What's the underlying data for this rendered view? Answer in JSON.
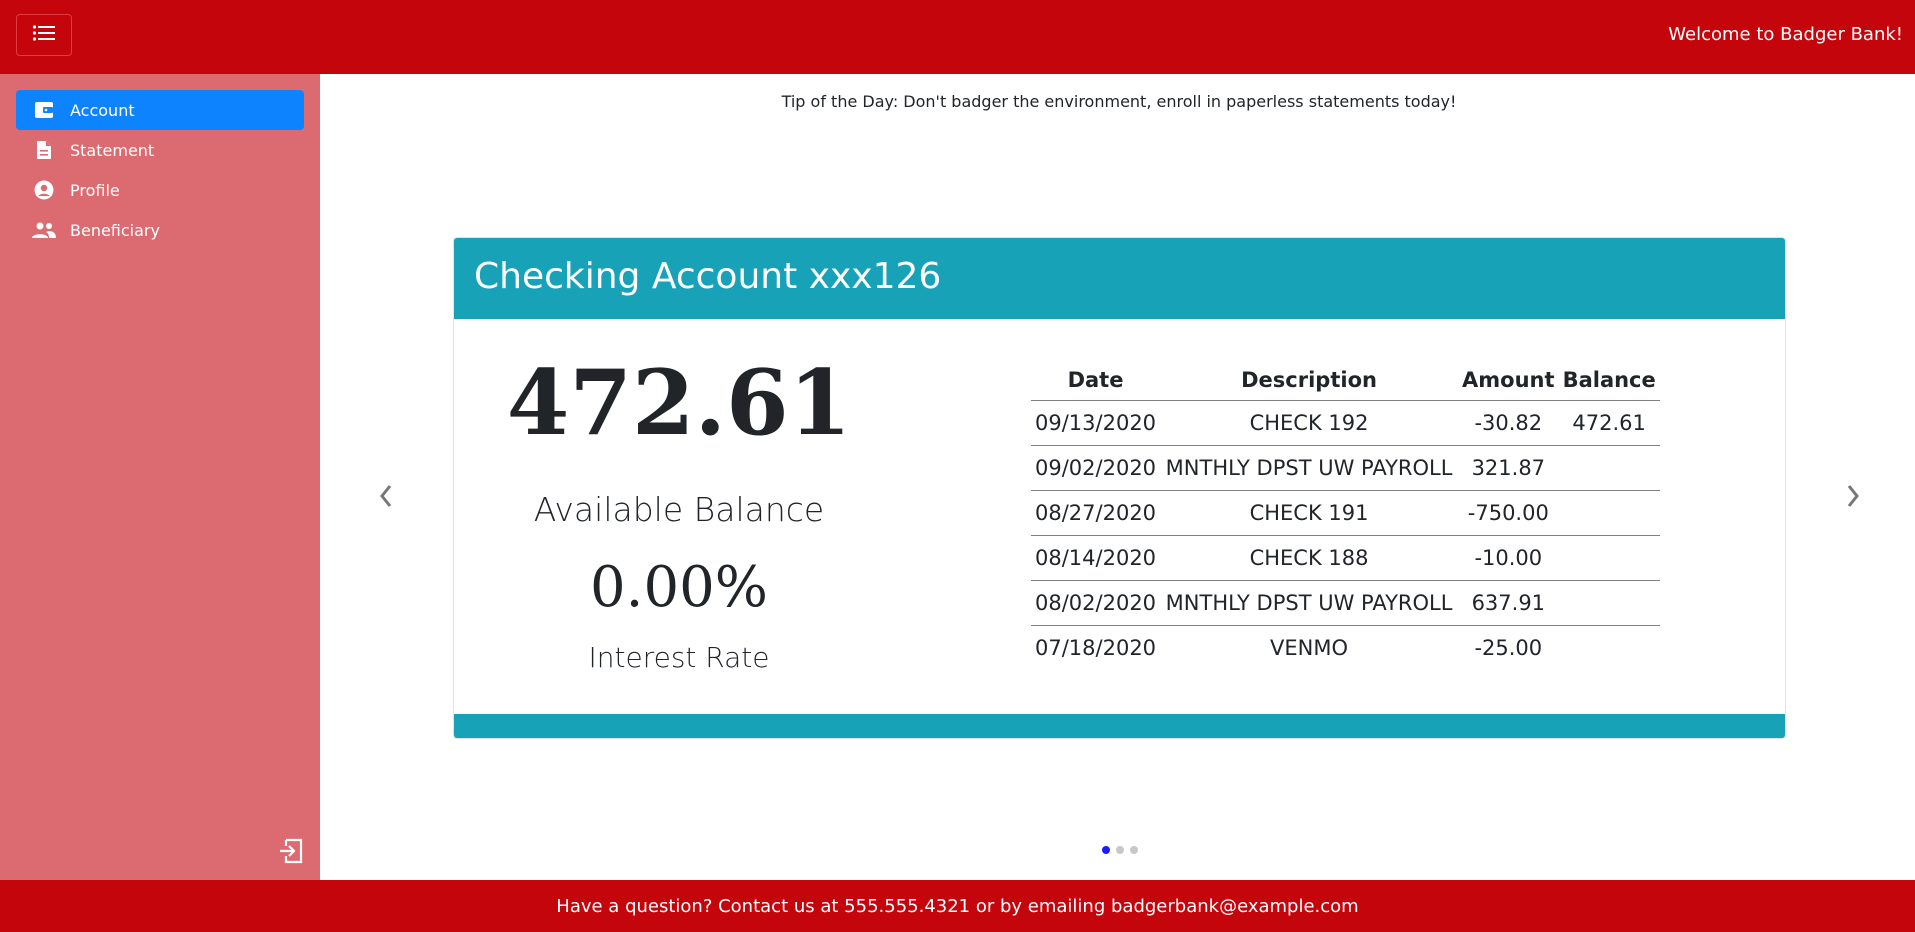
{
  "header": {
    "welcome": "Welcome to Badger Bank!",
    "menu_icon": "list-icon",
    "brand_color": "#c5050c"
  },
  "sidebar": {
    "items": [
      {
        "label": "Account",
        "icon": "wallet-icon",
        "active": true
      },
      {
        "label": "Statement",
        "icon": "document-icon",
        "active": false
      },
      {
        "label": "Profile",
        "icon": "user-circle-icon",
        "active": false
      },
      {
        "label": "Beneficiary",
        "icon": "people-icon",
        "active": false
      }
    ],
    "logout_icon": "logout-icon"
  },
  "main": {
    "tip": "Tip of the Day: Don't badger the environment, enroll in paperless statements today!",
    "account": {
      "title": "Checking Account xxx126",
      "balance": "472.61",
      "balance_label": "Available Balance",
      "rate": "0.00%",
      "rate_label": "Interest Rate",
      "columns": [
        "Date",
        "Description",
        "Amount",
        "Balance"
      ],
      "rows": [
        [
          "09/13/2020",
          "CHECK 192",
          "-30.82",
          "472.61"
        ],
        [
          "09/02/2020",
          "MNTHLY DPST UW PAYROLL",
          "321.87",
          ""
        ],
        [
          "08/27/2020",
          "CHECK 191",
          "-750.00",
          ""
        ],
        [
          "08/14/2020",
          "CHECK 188",
          "-10.00",
          ""
        ],
        [
          "08/02/2020",
          "MNTHLY DPST UW PAYROLL",
          "637.91",
          ""
        ],
        [
          "07/18/2020",
          "VENMO",
          "-25.00",
          ""
        ]
      ]
    },
    "carousel": {
      "slides": 3,
      "active_index": 0
    }
  },
  "footer": {
    "text": "Have a question? Contact us at 555.555.4321 or by emailing badgerbank@example.com"
  }
}
